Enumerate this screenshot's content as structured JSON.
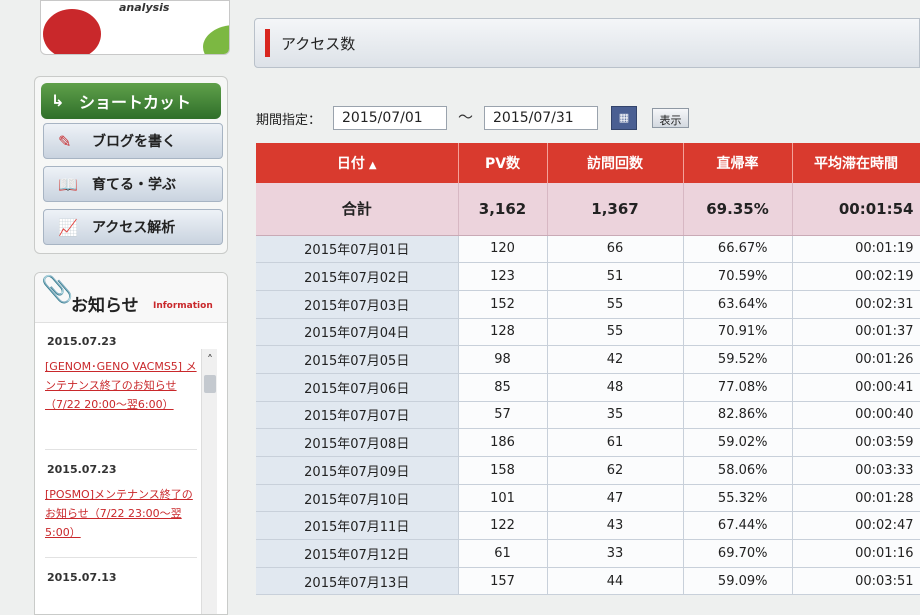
{
  "logo": {
    "tag": "analysis"
  },
  "shortcut": {
    "title": "ショートカット",
    "buttons": [
      {
        "label": "ブログを書く",
        "icon": "pencil-icon"
      },
      {
        "label": "育てる・学ぶ",
        "icon": "book-icon"
      },
      {
        "label": "アクセス解析",
        "icon": "chart-icon"
      }
    ]
  },
  "news": {
    "title": "お知らせ",
    "subtitle": "Information",
    "items": [
      {
        "date": "2015.07.23",
        "text": "[GENOM･GENO VACMS5] メンテナンス終了のお知らせ（7/22 20:00～翌6:00）"
      },
      {
        "date": "2015.07.23",
        "text": "[POSMO]メンテナンス終了のお知らせ（7/22 23:00～翌5:00）"
      },
      {
        "date": "2015.07.13",
        "text": ""
      }
    ]
  },
  "page": {
    "title": "アクセス数"
  },
  "period": {
    "label": "期間指定：",
    "from": "2015/07/01",
    "separator": "～",
    "to": "2015/07/31",
    "show_button": "表示"
  },
  "table": {
    "headers": [
      "日付",
      "PV数",
      "訪問回数",
      "直帰率",
      "平均滞在時間"
    ],
    "sort_indicator": "▲",
    "total": [
      "合計",
      "3,162",
      "1,367",
      "69.35%",
      "00:01:54"
    ],
    "rows": [
      [
        "2015年07月01日",
        "120",
        "66",
        "66.67%",
        "00:01:19"
      ],
      [
        "2015年07月02日",
        "123",
        "51",
        "70.59%",
        "00:02:19"
      ],
      [
        "2015年07月03日",
        "152",
        "55",
        "63.64%",
        "00:02:31"
      ],
      [
        "2015年07月04日",
        "128",
        "55",
        "70.91%",
        "00:01:37"
      ],
      [
        "2015年07月05日",
        "98",
        "42",
        "59.52%",
        "00:01:26"
      ],
      [
        "2015年07月06日",
        "85",
        "48",
        "77.08%",
        "00:00:41"
      ],
      [
        "2015年07月07日",
        "57",
        "35",
        "82.86%",
        "00:00:40"
      ],
      [
        "2015年07月08日",
        "186",
        "61",
        "59.02%",
        "00:03:59"
      ],
      [
        "2015年07月09日",
        "158",
        "62",
        "58.06%",
        "00:03:33"
      ],
      [
        "2015年07月10日",
        "101",
        "47",
        "55.32%",
        "00:01:28"
      ],
      [
        "2015年07月11日",
        "122",
        "43",
        "67.44%",
        "00:02:47"
      ],
      [
        "2015年07月12日",
        "61",
        "33",
        "69.70%",
        "00:01:16"
      ],
      [
        "2015年07月13日",
        "157",
        "44",
        "59.09%",
        "00:03:51"
      ]
    ]
  }
}
